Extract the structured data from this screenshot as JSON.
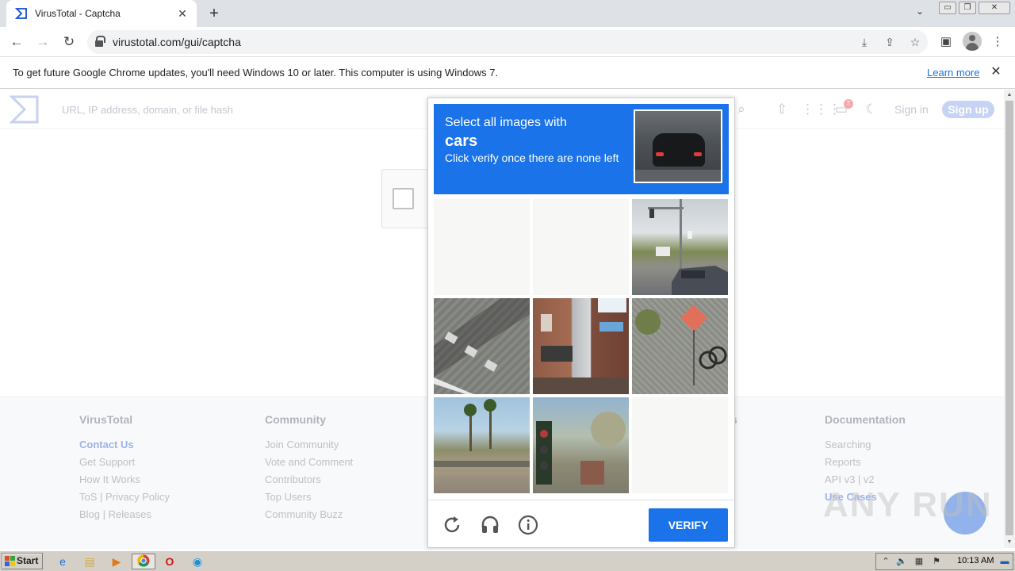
{
  "browser": {
    "tab_title": "VirusTotal - Captcha",
    "url": "virustotal.com/gui/captcha",
    "infobar_text": "To get future Google Chrome updates, you'll need Windows 10 or later. This computer is using Windows 7.",
    "infobar_link": "Learn more"
  },
  "vt": {
    "search_placeholder": "URL, IP address, domain, or file hash",
    "notification_count": "7",
    "sign_in": "Sign in",
    "sign_up": "Sign up",
    "brand_color": "#0b4dda"
  },
  "footer": {
    "columns": [
      {
        "title": "VirusTotal",
        "links": [
          "Contact Us",
          "Get Support",
          "How It Works",
          "ToS | Privacy Policy",
          "Blog | Releases"
        ]
      },
      {
        "title": "Community",
        "links": [
          "Join Community",
          "Vote and Comment",
          "Contributors",
          "Top Users",
          "Community Buzz"
        ]
      },
      {
        "title": "s",
        "links": []
      },
      {
        "title": "Documentation",
        "links": [
          "Searching",
          "Reports",
          "API v3 | v2",
          "Use Cases"
        ]
      }
    ]
  },
  "captcha": {
    "select_text": "Select all images with",
    "target": "cars",
    "instruction": "Click verify once there are none left",
    "verify_label": "VERIFY",
    "accent_color": "#1a73e8",
    "tiles": [
      "blank",
      "blank",
      "street-with-car",
      "road-markings",
      "building-storefront",
      "orange-sign",
      "palm-trees",
      "traffic-light",
      "blank"
    ]
  },
  "watermark": "ANY RUN",
  "taskbar": {
    "start_label": "Start",
    "clock": "10:13 AM"
  }
}
